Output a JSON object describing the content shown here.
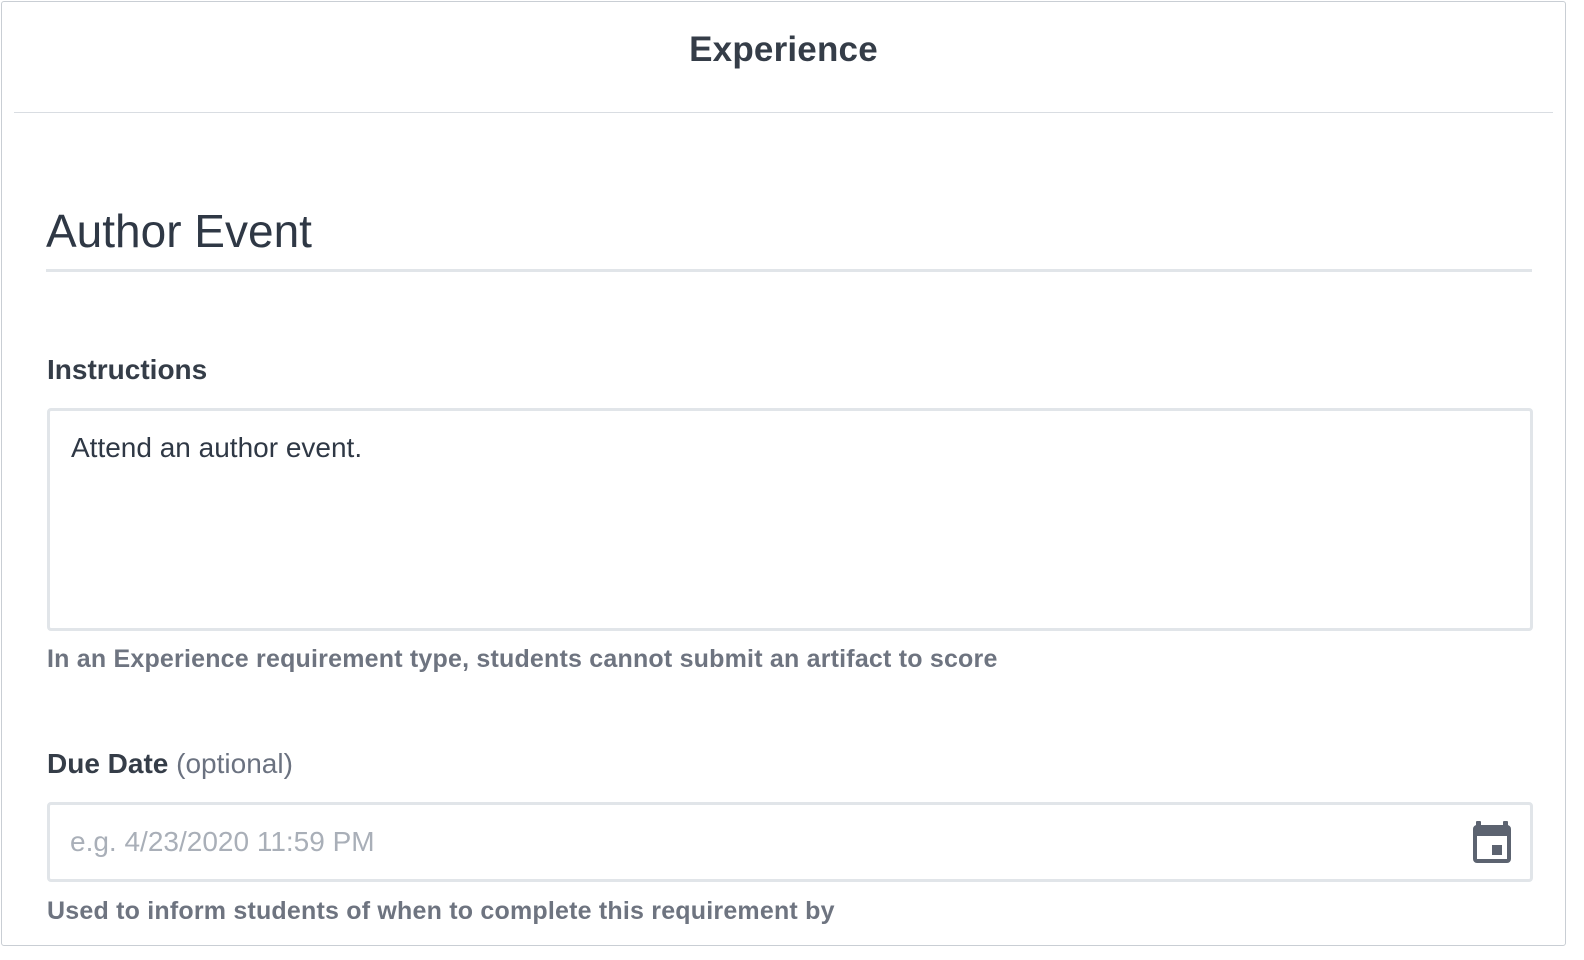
{
  "header": {
    "title": "Experience"
  },
  "form": {
    "title_value": "Author Event",
    "instructions": {
      "label": "Instructions",
      "value": "Attend an author event.",
      "help_text": "In an Experience requirement type, students cannot submit an artifact to score"
    },
    "due_date": {
      "label": "Due Date",
      "optional_label": "(optional)",
      "value": "",
      "placeholder": "e.g. 4/23/2020 11:59 PM",
      "help_text": "Used to inform students of when to complete this requirement by",
      "icon": "calendar-icon"
    }
  },
  "colors": {
    "text_primary": "#353d48",
    "text_secondary": "#6e7480",
    "border": "#e1e5e9",
    "placeholder": "#a9afb8",
    "icon": "#5c6370"
  }
}
